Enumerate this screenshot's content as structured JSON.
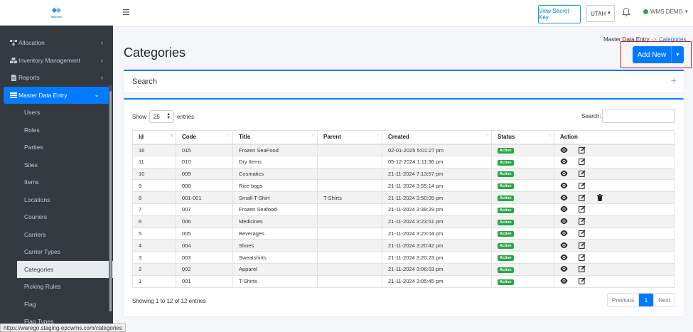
{
  "logo": {
    "text": "WareGo"
  },
  "sidebar": {
    "items": [
      {
        "label": "Allocation"
      },
      {
        "label": "Inventory Management"
      },
      {
        "label": "Reports"
      },
      {
        "label": "Master Data Entry"
      }
    ],
    "sub_items": [
      "Users",
      "Roles",
      "Parties",
      "Sites",
      "Items",
      "Locations",
      "Couriers",
      "Carriers",
      "Carrier Types",
      "Categories",
      "Picking Rules",
      "Flag",
      "Flag Types"
    ],
    "active_sub": "Categories"
  },
  "topbar": {
    "secret_button": "View Secret Key",
    "region": "UTAH",
    "user": "WMS DEMO"
  },
  "page": {
    "title": "Categories",
    "breadcrumb_parent": "Master Data Entry",
    "breadcrumb_arrow": "->",
    "breadcrumb_current": "Categories",
    "add_button": "Add New"
  },
  "search_panel": {
    "title": "Search"
  },
  "table": {
    "show_label": "Show",
    "page_length": "25",
    "entries_label": "entries",
    "search_label": "Search:",
    "columns": [
      "Id",
      "Code",
      "Title",
      "Parent",
      "Created",
      "Status",
      "Action"
    ],
    "rows": [
      {
        "id": "16",
        "code": "015",
        "title": "Frozen SeaFood",
        "parent": "",
        "created": "02-01-2025 5:01:27 pm",
        "status": "Active",
        "delete": false
      },
      {
        "id": "11",
        "code": "010",
        "title": "Dry Items",
        "parent": "",
        "created": "05-12-2024 1:11:36 pm",
        "status": "Active",
        "delete": false
      },
      {
        "id": "10",
        "code": "009",
        "title": "Cosmatics",
        "parent": "",
        "created": "21-11-2024 7:13:57 pm",
        "status": "Active",
        "delete": false
      },
      {
        "id": "9",
        "code": "008",
        "title": "Rice bags",
        "parent": "",
        "created": "21-11-2024 3:55:14 pm",
        "status": "Active",
        "delete": false
      },
      {
        "id": "8",
        "code": "001-001",
        "title": "Small-T-Shirt",
        "parent": "T-Shirts",
        "created": "21-11-2024 3:50:05 pm",
        "status": "Active",
        "delete": true
      },
      {
        "id": "7",
        "code": "007",
        "title": "Frozen Seafood",
        "parent": "",
        "created": "21-11-2024 3:39:29 pm",
        "status": "Active",
        "delete": false
      },
      {
        "id": "6",
        "code": "006",
        "title": "Medicines",
        "parent": "",
        "created": "21-11-2024 3:23:51 pm",
        "status": "Active",
        "delete": false
      },
      {
        "id": "5",
        "code": "005",
        "title": "Beverages",
        "parent": "",
        "created": "21-11-2024 3:23:04 pm",
        "status": "Active",
        "delete": false
      },
      {
        "id": "4",
        "code": "004",
        "title": "Shoes",
        "parent": "",
        "created": "21-11-2024 3:20:42 pm",
        "status": "Active",
        "delete": false
      },
      {
        "id": "3",
        "code": "003",
        "title": "Sweatshirts",
        "parent": "",
        "created": "21-11-2024 3:20:23 pm",
        "status": "Active",
        "delete": false
      },
      {
        "id": "2",
        "code": "002",
        "title": "Apparel",
        "parent": "",
        "created": "21-11-2024 3:06:03 pm",
        "status": "Active",
        "delete": false
      },
      {
        "id": "1",
        "code": "001",
        "title": "T-Shirts",
        "parent": "",
        "created": "21-11-2024 3:05:45 pm",
        "status": "Active",
        "delete": false
      }
    ],
    "info": "Showing 1 to 12 of 12 entries",
    "prev_label": "Previous",
    "current_page": "1",
    "next_label": "Next"
  },
  "status_url": "https://warego.staging-epcwms.com/categories",
  "colors": {
    "primary": "#007bff",
    "sidebar": "#343a40",
    "success": "#28a745",
    "highlight": "#e0141e"
  }
}
